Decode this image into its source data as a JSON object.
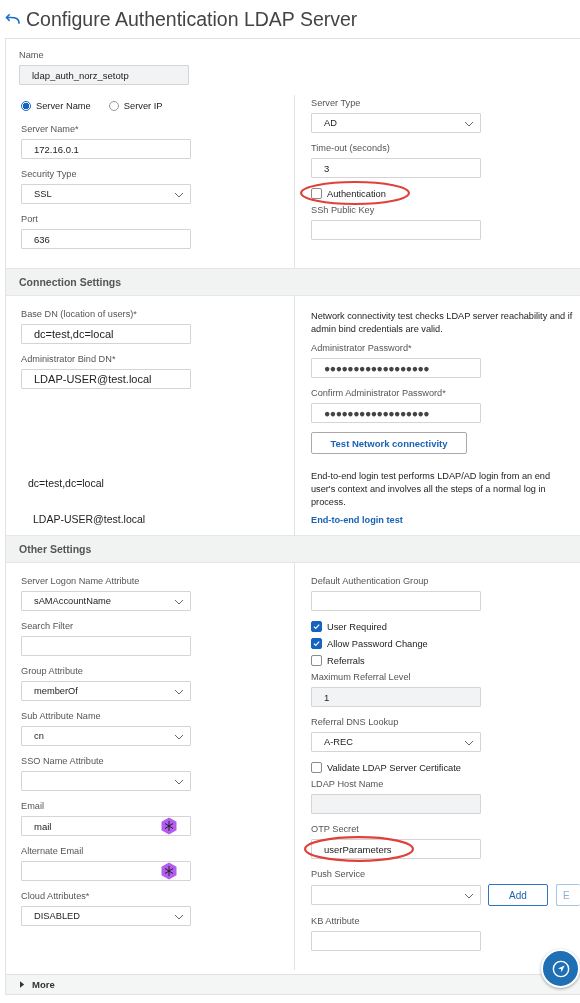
{
  "page_title": "Configure Authentication LDAP Server",
  "name_field": {
    "label": "Name",
    "value": "ldap_auth_norz_setotp"
  },
  "sections": [
    {
      "left": [
        {
          "kind": "radios",
          "options": [
            {
              "label": "Server Name",
              "selected": true
            },
            {
              "label": "Server IP",
              "selected": false
            }
          ]
        },
        {
          "kind": "text",
          "label": "Server Name*",
          "value": "172.16.0.1"
        },
        {
          "kind": "select",
          "label": "Security Type",
          "value": "SSL"
        },
        {
          "kind": "text",
          "label": "Port",
          "value": "636"
        }
      ],
      "right": [
        {
          "kind": "select",
          "label": "Server Type",
          "value": "AD",
          "highlighted": false
        },
        {
          "kind": "text",
          "label": "Time-out (seconds)",
          "value": "3",
          "highlighted": false
        },
        {
          "kind": "checkbox",
          "label": "Authentication",
          "checked": false,
          "highlighted": true
        },
        {
          "kind": "text",
          "label": "SSh Public Key",
          "highlighted": false
        }
      ]
    },
    {
      "title": "Connection Settings",
      "left": [
        {
          "kind": "text",
          "label": "Base DN (location of users)*",
          "value": "dc=test,dc=local"
        },
        {
          "kind": "text",
          "label": "Administrator Bind DN*",
          "value": "LDAP-USER@test.local"
        },
        {
          "kind": "pasted",
          "text": "dc=test,dc=local"
        },
        {
          "kind": "pasted",
          "text": "LDAP-USER@test.local"
        }
      ],
      "right": [
        {
          "kind": "note",
          "text": "Network connectivity test checks LDAP server reachability and if admin bind credentials are valid."
        },
        {
          "kind": "password",
          "label": "Administrator Password*",
          "value": "●●●●●●●●●●●●●●●●●●"
        },
        {
          "kind": "password",
          "label": "Confirm Administrator Password*",
          "value": "●●●●●●●●●●●●●●●●●●"
        },
        {
          "kind": "button",
          "label": "Test Network connectivity"
        },
        {
          "kind": "note",
          "text": "End-to-end login test performs LDAP/AD login from an end user's context and involves all the steps of a normal log in process."
        },
        {
          "kind": "link",
          "label": "End-to-end login test"
        }
      ]
    },
    {
      "title": "Other Settings",
      "left": [
        {
          "kind": "select",
          "label": "Server Logon Name Attribute",
          "value": "sAMAccountName"
        },
        {
          "kind": "text",
          "label": "Search Filter"
        },
        {
          "kind": "select",
          "label": "Group Attribute",
          "value": "memberOf"
        },
        {
          "kind": "select",
          "label": "Sub Attribute Name",
          "value": "cn"
        },
        {
          "kind": "select",
          "label": "SSO Name Attribute"
        },
        {
          "kind": "attribute",
          "label": "Email",
          "value": "mail"
        },
        {
          "kind": "attribute",
          "label": "Alternate Email"
        },
        {
          "kind": "select",
          "label": "Cloud Attributes*",
          "value": "DISABLED"
        }
      ],
      "right": [
        {
          "kind": "text",
          "label": "Default Authentication Group",
          "highlighted": false
        },
        {
          "kind": "checkbox",
          "label": "User Required",
          "checked": true,
          "highlighted": false
        },
        {
          "kind": "checkbox",
          "label": "Allow Password Change",
          "checked": true,
          "highlighted": false
        },
        {
          "kind": "checkbox",
          "label": "Referrals",
          "checked": false,
          "highlighted": false
        },
        {
          "kind": "readonly",
          "label": "Maximum Referral Level",
          "value": "1",
          "highlighted": false
        },
        {
          "kind": "select",
          "label": "Referral DNS Lookup",
          "value": "A-REC",
          "highlighted": false
        },
        {
          "kind": "checkbox",
          "label": "Validate LDAP Server Certificate",
          "checked": false,
          "highlighted": false
        },
        {
          "kind": "readonly",
          "label": "LDAP Host Name",
          "highlighted": false
        },
        {
          "kind": "text",
          "label": "OTP Secret",
          "value": "userParameters",
          "highlighted": true
        },
        {
          "kind": "select-buttons",
          "label": "Push Service",
          "buttons": [
            "Add",
            "E"
          ],
          "highlighted": false
        },
        {
          "kind": "text",
          "label": "KB Attribute",
          "highlighted": false
        }
      ]
    }
  ],
  "more": {
    "label": "More",
    "expanded": false
  }
}
